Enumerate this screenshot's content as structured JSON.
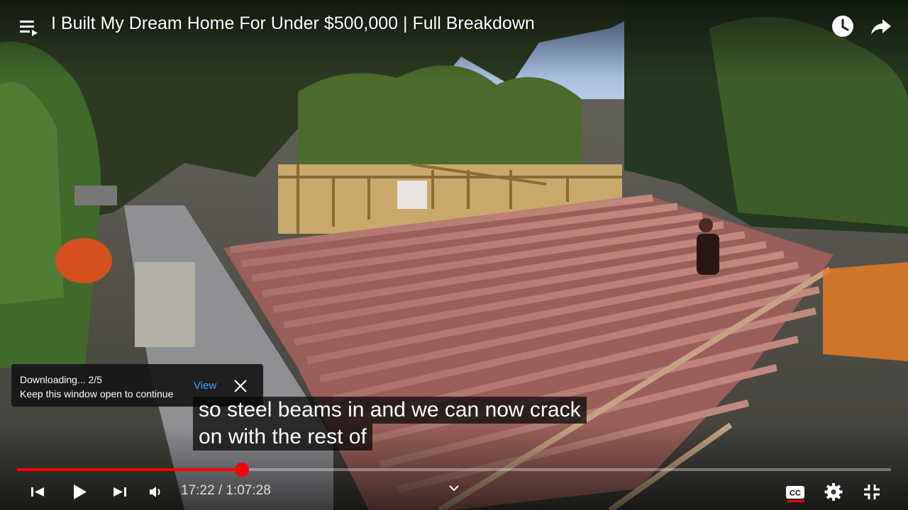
{
  "video": {
    "title": "I Built My Dream Home For Under $500,000 | Full Breakdown"
  },
  "header": {
    "icons": [
      "playlist-icon",
      "watch-later-icon",
      "share-icon"
    ]
  },
  "download_toast": {
    "status": "Downloading... 2/5",
    "message": "Keep this window open to continue",
    "view_label": "View"
  },
  "captions": {
    "line1": "so steel beams in and we can now crack",
    "line2": "on with the rest of"
  },
  "playback": {
    "current_time": "17:22",
    "duration": "1:07:28",
    "progress_fraction": 0.2574,
    "time_display": "17:22 / 1:07:28"
  },
  "colors": {
    "progress": "#ff0000",
    "link": "#3ea6ff"
  },
  "controls": {
    "left_icons": [
      "previous-icon",
      "play-icon",
      "next-icon",
      "volume-icon"
    ],
    "right_icons": [
      "captions-icon",
      "settings-icon",
      "exit-fullscreen-icon"
    ],
    "captions_on": true
  }
}
